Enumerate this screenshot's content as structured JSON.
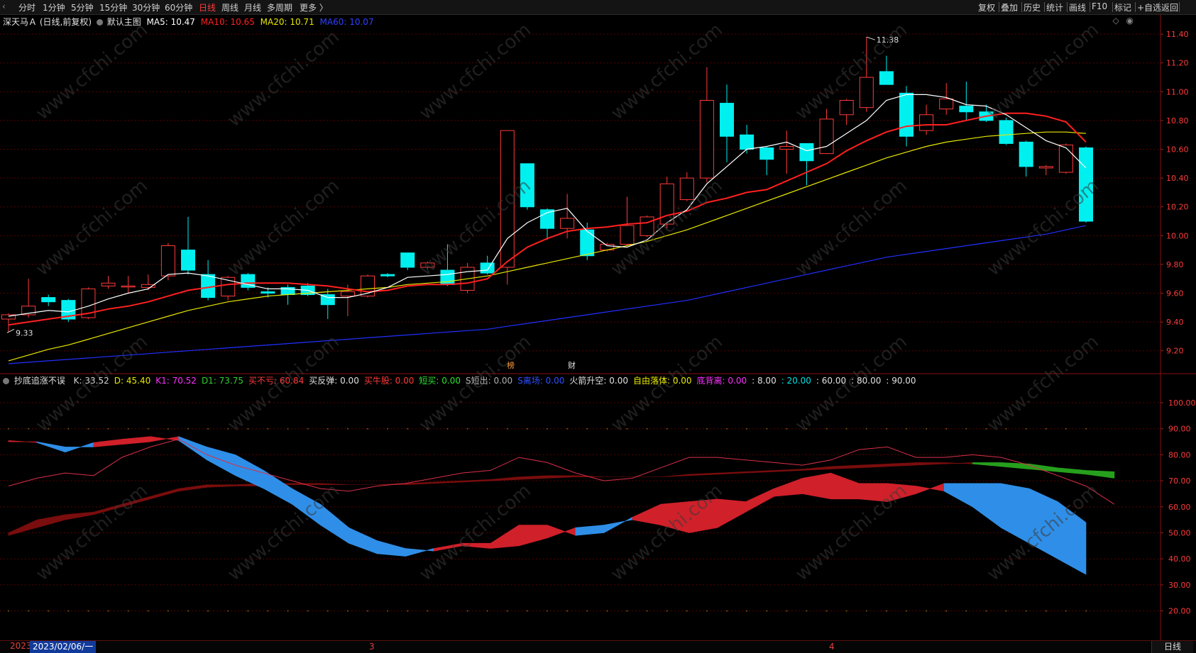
{
  "topbar": {
    "periods": [
      "分时",
      "1分钟",
      "5分钟",
      "15分钟",
      "30分钟",
      "60分钟",
      "日线",
      "周线",
      "月线",
      "多周期",
      "更多"
    ],
    "active_period": "日线",
    "right_tools": [
      "复权",
      "叠加",
      "历史",
      "统计",
      "画线",
      "F10",
      "标记",
      "+自选",
      "返回"
    ]
  },
  "main_legend": {
    "stock": "深天马Ａ",
    "mode": "(日线,前复权)",
    "template": "默认主图",
    "ma5": "MA5: 10.47",
    "ma10": "MA10: 10.65",
    "ma20": "MA20: 10.71",
    "ma60": "MA60: 10.07"
  },
  "colors": {
    "up": "#ff3b3b",
    "down": "#00f0f0",
    "ma5": "#ffffff",
    "ma10": "#ff2020",
    "ma20": "#e8e800",
    "ma60": "#2030ff",
    "grid": "#5a0000",
    "axis": "#ff3b3b"
  },
  "chart_data": {
    "type": "candlestick",
    "price_axis": {
      "min": 9.1,
      "max": 11.45,
      "ticks": [
        9.2,
        9.4,
        9.6,
        9.8,
        10.0,
        10.2,
        10.4,
        10.6,
        10.8,
        11.0,
        11.2,
        11.4
      ]
    },
    "candles": [
      {
        "o": 9.42,
        "h": 9.46,
        "l": 9.33,
        "c": 9.45
      },
      {
        "o": 9.45,
        "h": 9.7,
        "l": 9.43,
        "c": 9.51
      },
      {
        "o": 9.57,
        "h": 9.59,
        "l": 9.51,
        "c": 9.54
      },
      {
        "o": 9.55,
        "h": 9.56,
        "l": 9.4,
        "c": 9.42
      },
      {
        "o": 9.43,
        "h": 9.64,
        "l": 9.42,
        "c": 9.63
      },
      {
        "o": 9.65,
        "h": 9.72,
        "l": 9.63,
        "c": 9.67
      },
      {
        "o": 9.65,
        "h": 9.72,
        "l": 9.6,
        "c": 9.65
      },
      {
        "o": 9.64,
        "h": 9.73,
        "l": 9.62,
        "c": 9.66
      },
      {
        "o": 9.72,
        "h": 9.95,
        "l": 9.69,
        "c": 9.93
      },
      {
        "o": 9.9,
        "h": 10.13,
        "l": 9.73,
        "c": 9.76
      },
      {
        "o": 9.73,
        "h": 9.83,
        "l": 9.55,
        "c": 9.57
      },
      {
        "o": 9.58,
        "h": 9.72,
        "l": 9.55,
        "c": 9.71
      },
      {
        "o": 9.73,
        "h": 9.74,
        "l": 9.62,
        "c": 9.64
      },
      {
        "o": 9.61,
        "h": 9.64,
        "l": 9.57,
        "c": 9.6
      },
      {
        "o": 9.64,
        "h": 9.66,
        "l": 9.52,
        "c": 9.59
      },
      {
        "o": 9.65,
        "h": 9.67,
        "l": 9.58,
        "c": 9.59
      },
      {
        "o": 9.59,
        "h": 9.63,
        "l": 9.42,
        "c": 9.52
      },
      {
        "o": 9.58,
        "h": 9.66,
        "l": 9.44,
        "c": 9.61
      },
      {
        "o": 9.58,
        "h": 9.73,
        "l": 9.57,
        "c": 9.72
      },
      {
        "o": 9.73,
        "h": 9.74,
        "l": 9.71,
        "c": 9.72
      },
      {
        "o": 9.88,
        "h": 9.88,
        "l": 9.76,
        "c": 9.78
      },
      {
        "o": 9.78,
        "h": 9.82,
        "l": 9.77,
        "c": 9.81
      },
      {
        "o": 9.76,
        "h": 9.94,
        "l": 9.65,
        "c": 9.66
      },
      {
        "o": 9.62,
        "h": 9.81,
        "l": 9.6,
        "c": 9.78
      },
      {
        "o": 9.81,
        "h": 9.86,
        "l": 9.73,
        "c": 9.74
      },
      {
        "o": 9.78,
        "h": 10.73,
        "l": 9.66,
        "c": 10.73
      },
      {
        "o": 10.5,
        "h": 10.5,
        "l": 10.18,
        "c": 10.2
      },
      {
        "o": 10.18,
        "h": 10.19,
        "l": 9.97,
        "c": 10.05
      },
      {
        "o": 10.05,
        "h": 10.29,
        "l": 9.98,
        "c": 10.12
      },
      {
        "o": 10.04,
        "h": 10.09,
        "l": 9.83,
        "c": 9.86
      },
      {
        "o": 9.9,
        "h": 9.95,
        "l": 9.89,
        "c": 9.94
      },
      {
        "o": 9.94,
        "h": 10.27,
        "l": 9.93,
        "c": 10.07
      },
      {
        "o": 10.0,
        "h": 10.14,
        "l": 9.99,
        "c": 10.13
      },
      {
        "o": 10.08,
        "h": 10.41,
        "l": 10.05,
        "c": 10.36
      },
      {
        "o": 10.25,
        "h": 10.44,
        "l": 10.24,
        "c": 10.4
      },
      {
        "o": 10.4,
        "h": 11.17,
        "l": 10.37,
        "c": 10.94
      },
      {
        "o": 10.92,
        "h": 11.05,
        "l": 10.51,
        "c": 10.69
      },
      {
        "o": 10.7,
        "h": 10.77,
        "l": 10.57,
        "c": 10.6
      },
      {
        "o": 10.61,
        "h": 10.62,
        "l": 10.42,
        "c": 10.53
      },
      {
        "o": 10.6,
        "h": 10.73,
        "l": 10.43,
        "c": 10.62
      },
      {
        "o": 10.64,
        "h": 10.64,
        "l": 10.35,
        "c": 10.52
      },
      {
        "o": 10.57,
        "h": 10.88,
        "l": 10.57,
        "c": 10.81
      },
      {
        "o": 10.84,
        "h": 10.95,
        "l": 10.77,
        "c": 10.94
      },
      {
        "o": 10.89,
        "h": 11.38,
        "l": 10.86,
        "c": 11.1
      },
      {
        "o": 11.14,
        "h": 11.25,
        "l": 11.05,
        "c": 11.05
      },
      {
        "o": 10.99,
        "h": 11.04,
        "l": 10.62,
        "c": 10.69
      },
      {
        "o": 10.73,
        "h": 10.91,
        "l": 10.7,
        "c": 10.84
      },
      {
        "o": 10.88,
        "h": 11.06,
        "l": 10.84,
        "c": 10.95
      },
      {
        "o": 10.9,
        "h": 11.07,
        "l": 10.8,
        "c": 10.86
      },
      {
        "o": 10.86,
        "h": 10.91,
        "l": 10.79,
        "c": 10.8
      },
      {
        "o": 10.8,
        "h": 10.82,
        "l": 10.63,
        "c": 10.64
      },
      {
        "o": 10.65,
        "h": 10.66,
        "l": 10.41,
        "c": 10.48
      },
      {
        "o": 10.47,
        "h": 10.49,
        "l": 10.42,
        "c": 10.48
      },
      {
        "o": 10.44,
        "h": 10.64,
        "l": 10.43,
        "c": 10.63
      },
      {
        "o": 10.61,
        "h": 10.62,
        "l": 10.09,
        "c": 10.1
      }
    ],
    "ma5": [
      9.44,
      9.46,
      9.48,
      9.47,
      9.51,
      9.56,
      9.6,
      9.63,
      9.73,
      9.74,
      9.72,
      9.69,
      9.66,
      9.63,
      9.63,
      9.62,
      9.57,
      9.57,
      9.6,
      9.64,
      9.71,
      9.72,
      9.73,
      9.75,
      9.76,
      9.98,
      10.09,
      10.16,
      10.19,
      10.03,
      9.93,
      9.92,
      9.97,
      10.09,
      10.18,
      10.36,
      10.48,
      10.6,
      10.62,
      10.65,
      10.59,
      10.62,
      10.71,
      10.8,
      10.94,
      10.98,
      10.98,
      10.96,
      10.91,
      10.9,
      10.84,
      10.75,
      10.66,
      10.61,
      10.47
    ],
    "ma10": [
      9.38,
      9.4,
      9.42,
      9.44,
      9.46,
      9.49,
      9.51,
      9.54,
      9.58,
      9.62,
      9.64,
      9.66,
      9.67,
      9.67,
      9.67,
      9.66,
      9.65,
      9.63,
      9.61,
      9.62,
      9.65,
      9.66,
      9.66,
      9.67,
      9.7,
      9.82,
      9.92,
      9.98,
      10.03,
      10.05,
      10.06,
      10.08,
      10.09,
      10.14,
      10.17,
      10.23,
      10.26,
      10.3,
      10.32,
      10.38,
      10.44,
      10.5,
      10.59,
      10.66,
      10.72,
      10.76,
      10.77,
      10.77,
      10.8,
      10.83,
      10.85,
      10.85,
      10.83,
      10.79,
      10.65
    ],
    "ma20": [
      9.13,
      9.17,
      9.21,
      9.24,
      9.28,
      9.32,
      9.36,
      9.4,
      9.44,
      9.48,
      9.51,
      9.54,
      9.56,
      9.58,
      9.59,
      9.6,
      9.61,
      9.62,
      9.63,
      9.64,
      9.66,
      9.67,
      9.68,
      9.7,
      9.72,
      9.75,
      9.78,
      9.81,
      9.84,
      9.87,
      9.9,
      9.93,
      9.96,
      10.0,
      10.04,
      10.09,
      10.14,
      10.19,
      10.24,
      10.29,
      10.34,
      10.39,
      10.44,
      10.49,
      10.54,
      10.58,
      10.62,
      10.65,
      10.67,
      10.69,
      10.7,
      10.71,
      10.72,
      10.72,
      10.71
    ],
    "ma60": [
      9.11,
      9.12,
      9.13,
      9.14,
      9.15,
      9.16,
      9.17,
      9.18,
      9.19,
      9.2,
      9.21,
      9.22,
      9.23,
      9.24,
      9.25,
      9.26,
      9.27,
      9.28,
      9.29,
      9.3,
      9.31,
      9.32,
      9.33,
      9.34,
      9.35,
      9.37,
      9.39,
      9.41,
      9.43,
      9.45,
      9.47,
      9.49,
      9.51,
      9.53,
      9.55,
      9.58,
      9.61,
      9.64,
      9.67,
      9.7,
      9.73,
      9.76,
      9.79,
      9.82,
      9.85,
      9.87,
      9.89,
      9.91,
      9.93,
      9.95,
      9.97,
      9.99,
      10.01,
      10.04,
      10.07
    ],
    "annotations": {
      "high": "11.38",
      "low": "9.33",
      "event_marks": [
        "榜",
        "财"
      ]
    },
    "indicator": {
      "axis": {
        "min": 12,
        "max": 106,
        "ticks": [
          "20.00",
          "30.00",
          "40.00",
          "50.00",
          "60.00",
          "70.00",
          "80.00",
          "90.00",
          "100.00"
        ]
      },
      "K": [
        85.5,
        84.7,
        81.0,
        84.7,
        86.0,
        87.0,
        85.5,
        78.0,
        72.0,
        67.0,
        61.0,
        53.0,
        46.0,
        42.0,
        41.0,
        44.0,
        46.0,
        46.0,
        53.0,
        53.0,
        49.0,
        50.0,
        56.0,
        61.0,
        62.0,
        63.0,
        62.0,
        67.0,
        71.0,
        73.0,
        69.0,
        69.0,
        68.0,
        66.0,
        60.0,
        52.0,
        46.0,
        40.0,
        34.0
      ],
      "D": [
        85.0,
        85.0,
        83.0,
        83.0,
        84.0,
        85.0,
        87.0,
        83.0,
        80.0,
        74.0,
        67.0,
        61.0,
        52.0,
        47.0,
        44.0,
        43.0,
        45.0,
        44.0,
        45.0,
        48.0,
        52.0,
        53.0,
        55.0,
        53.0,
        50.0,
        52.0,
        58.0,
        64.0,
        65.0,
        63.0,
        63.0,
        62.0,
        65.0,
        69.0,
        69.0,
        69.0,
        67.0,
        62.0,
        54.0,
        45.0
      ],
      "K1": [
        50.0,
        55.0,
        57.0,
        58.0,
        61.0,
        64.0,
        67.0,
        68.5,
        68.5,
        69.0,
        69.0,
        69.0,
        68.5,
        68.5,
        69.0,
        69.5,
        70.0,
        70.5,
        71.5,
        72.0,
        72.0,
        71.5,
        71.5,
        71.5,
        72.5,
        73.0,
        73.5,
        74.0,
        74.5,
        75.5,
        76.0,
        76.5,
        77.0,
        77.0,
        76.5,
        75.5,
        74.5,
        73.5,
        72.5,
        71.0
      ],
      "D1": [
        49.0,
        52.0,
        55.0,
        57.0,
        60.0,
        63.0,
        66.0,
        67.5,
        68.0,
        68.0,
        68.5,
        68.5,
        68.5,
        68.5,
        68.5,
        69.0,
        69.5,
        70.0,
        70.5,
        71.0,
        71.5,
        71.5,
        71.5,
        71.5,
        72.0,
        72.5,
        73.0,
        73.5,
        74.0,
        74.5,
        75.0,
        75.5,
        76.0,
        76.5,
        77.0,
        77.0,
        76.5,
        75.0,
        74.0,
        73.5
      ],
      "thin": [
        68.0,
        71.0,
        73.0,
        72.0,
        79.0,
        83.0,
        86.0,
        80.0,
        76.0,
        73.0,
        70.0,
        67.0,
        66.0,
        68.0,
        69.0,
        71.0,
        73.0,
        74.0,
        79.0,
        77.0,
        73.0,
        70.0,
        71.0,
        75.0,
        79.0,
        79.0,
        78.0,
        77.0,
        76.0,
        78.0,
        82.0,
        83.0,
        79.0,
        79.0,
        80.0,
        79.0,
        76.0,
        72.0,
        68.0,
        61.0
      ]
    }
  },
  "indicator_legend": {
    "name": "抄底追涨不误",
    "items": [
      {
        "label": "K: 33.52",
        "color": "#d0d0d0"
      },
      {
        "label": "D: 45.40",
        "color": "#e8e800"
      },
      {
        "label": "K1: 70.52",
        "color": "#ff30ff"
      },
      {
        "label": "D1: 73.75",
        "color": "#30d030"
      },
      {
        "label": "买不亏: 60.84",
        "color": "#ff3b3b"
      },
      {
        "label": "买反弹: 0.00",
        "color": "#e0e0e0"
      },
      {
        "label": "买牛股: 0.00",
        "color": "#ff3b3b"
      },
      {
        "label": "短买: 0.00",
        "color": "#30e030"
      },
      {
        "label": "S短出: 0.00",
        "color": "#b0b0b0"
      },
      {
        "label": "S离场: 0.00",
        "color": "#3050ff"
      },
      {
        "label": "火箭升空: 0.00",
        "color": "#e0e0e0"
      },
      {
        "label": "自由落体: 0.00",
        "color": "#e8e800"
      },
      {
        "label": "底背离: 0.00",
        "color": "#ff30ff"
      },
      {
        "label": ": 8.00",
        "color": "#e0e0e0"
      },
      {
        "label": ": 20.00",
        "color": "#00e0e0"
      },
      {
        "label": ": 60.00",
        "color": "#e0e0e0"
      },
      {
        "label": ": 80.00",
        "color": "#e0e0e0"
      },
      {
        "label": ": 90.00",
        "color": "#e0e0e0"
      }
    ]
  },
  "bottombar": {
    "left_year": "2023",
    "date_cursor": "2023/02/06/一",
    "month_marks": [
      "3",
      "4"
    ],
    "period_tag": "日线"
  }
}
